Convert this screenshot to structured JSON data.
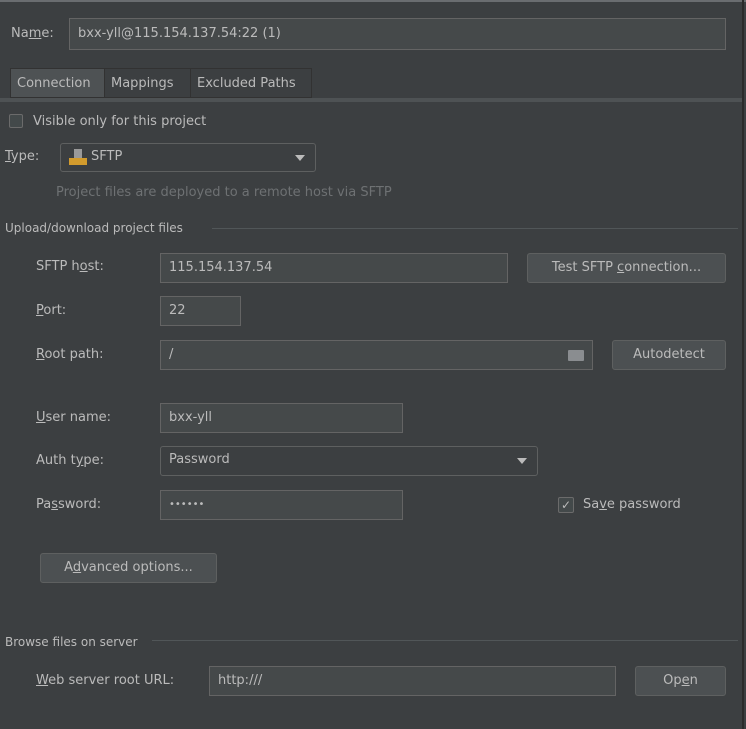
{
  "name": {
    "label": "Name:",
    "value": "bxx-yll@115.154.137.54:22 (1)"
  },
  "tabs": [
    {
      "label": "Connection",
      "selected": true
    },
    {
      "label": "Mappings",
      "selected": false
    },
    {
      "label": "Excluded Paths",
      "selected": false
    }
  ],
  "visible_only": {
    "label": "Visible only for this project",
    "checked": false
  },
  "type": {
    "label": "Type:",
    "value": "SFTP",
    "icon": "sftp-server-icon",
    "hint": "Project files are deployed to a remote host via SFTP"
  },
  "upload_section": {
    "title": "Upload/download project files",
    "sftp_host": {
      "label": "SFTP host:",
      "value": "115.154.137.54"
    },
    "test_button": "Test SFTP connection...",
    "port": {
      "label": "Port:",
      "value": "22"
    },
    "root_path": {
      "label": "Root path:",
      "value": "/",
      "icon": "folder-icon"
    },
    "autodetect_button": "Autodetect",
    "user_name": {
      "label": "User name:",
      "value": "bxx-yll"
    },
    "auth_type": {
      "label": "Auth type:",
      "value": "Password"
    },
    "password": {
      "label": "Password:",
      "value": "••••••"
    },
    "save_password": {
      "label": "Save password",
      "checked": true
    },
    "advanced_button": "Advanced options..."
  },
  "browse_section": {
    "title": "Browse files on server",
    "web_root": {
      "label": "Web server root URL:",
      "value": "http:///"
    },
    "open_button": "Open"
  }
}
